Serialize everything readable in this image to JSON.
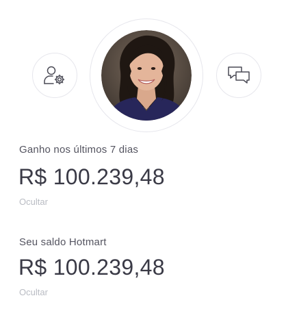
{
  "header": {
    "settings_icon": "user-settings-icon",
    "chat_icon": "chat-bubbles-icon",
    "avatar_alt": "profile-photo"
  },
  "earnings": {
    "label": "Ganho nos últimos 7 dias",
    "amount": "R$ 100.239,48",
    "hide_label": "Ocultar"
  },
  "balance": {
    "label": "Seu saldo Hotmart",
    "amount": "R$ 100.239,48",
    "hide_label": "Ocultar"
  },
  "colors": {
    "text_primary": "#3a3a46",
    "text_secondary": "#53535f",
    "text_muted": "#b9bcc3",
    "border": "#e6e6ec"
  }
}
